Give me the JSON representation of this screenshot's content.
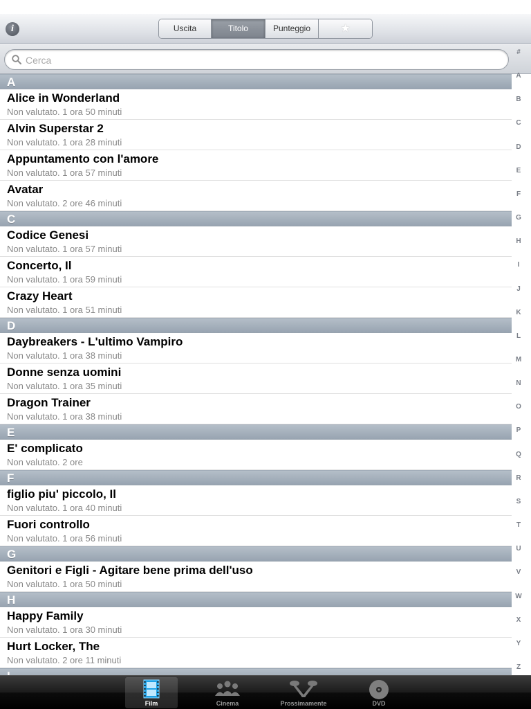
{
  "toolbar": {
    "info_label": "i",
    "segments": [
      {
        "label": "Uscita",
        "selected": false
      },
      {
        "label": "Titolo",
        "selected": true
      },
      {
        "label": "Punteggio",
        "selected": false
      },
      {
        "label": "★",
        "selected": false
      }
    ]
  },
  "search": {
    "placeholder": "Cerca",
    "value": ""
  },
  "sections": [
    {
      "letter": "A",
      "items": [
        {
          "title": "Alice in Wonderland",
          "subtitle": "Non valutato. 1 ora 50 minuti"
        },
        {
          "title": "Alvin Superstar 2",
          "subtitle": "Non valutato. 1 ora 28 minuti"
        },
        {
          "title": "Appuntamento con l'amore",
          "subtitle": "Non valutato. 1 ora 57 minuti"
        },
        {
          "title": "Avatar",
          "subtitle": "Non valutato. 2 ore 46 minuti"
        }
      ]
    },
    {
      "letter": "C",
      "items": [
        {
          "title": "Codice Genesi",
          "subtitle": "Non valutato. 1 ora 57 minuti"
        },
        {
          "title": "Concerto, Il",
          "subtitle": "Non valutato. 1 ora 59 minuti"
        },
        {
          "title": "Crazy Heart",
          "subtitle": "Non valutato. 1 ora 51 minuti"
        }
      ]
    },
    {
      "letter": "D",
      "items": [
        {
          "title": "Daybreakers - L'ultimo Vampiro",
          "subtitle": "Non valutato. 1 ora 38 minuti"
        },
        {
          "title": "Donne senza uomini",
          "subtitle": "Non valutato. 1 ora 35 minuti"
        },
        {
          "title": "Dragon Trainer",
          "subtitle": "Non valutato. 1 ora 38 minuti"
        }
      ]
    },
    {
      "letter": "E",
      "items": [
        {
          "title": "E' complicato",
          "subtitle": "Non valutato. 2 ore"
        }
      ]
    },
    {
      "letter": "F",
      "items": [
        {
          "title": "figlio piu' piccolo, Il",
          "subtitle": "Non valutato. 1 ora 40 minuti"
        },
        {
          "title": "Fuori controllo",
          "subtitle": "Non valutato. 1 ora 56 minuti"
        }
      ]
    },
    {
      "letter": "G",
      "items": [
        {
          "title": "Genitori e Figli - Agitare bene prima dell'uso",
          "subtitle": "Non valutato. 1 ora 50 minuti"
        }
      ]
    },
    {
      "letter": "H",
      "items": [
        {
          "title": "Happy Family",
          "subtitle": "Non valutato. 1 ora 30 minuti"
        },
        {
          "title": "Hurt Locker, The",
          "subtitle": "Non valutato. 2 ore 11 minuti"
        }
      ]
    },
    {
      "letter": "I",
      "items": []
    }
  ],
  "index_letters": [
    "#",
    "A",
    "B",
    "C",
    "D",
    "E",
    "F",
    "G",
    "H",
    "I",
    "J",
    "K",
    "L",
    "M",
    "N",
    "O",
    "P",
    "Q",
    "R",
    "S",
    "T",
    "U",
    "V",
    "W",
    "X",
    "Y",
    "Z"
  ],
  "tabbar": {
    "tabs": [
      {
        "label": "Film",
        "icon": "film-icon",
        "active": true
      },
      {
        "label": "Cinema",
        "icon": "audience-icon",
        "active": false
      },
      {
        "label": "Prossimamente",
        "icon": "spotlights-icon",
        "active": false
      },
      {
        "label": "DVD",
        "icon": "disc-icon",
        "active": false
      }
    ]
  },
  "colors": {
    "section_header": "#a8b3bf",
    "active_segment": "#858b94",
    "tabbar": "#141414"
  }
}
